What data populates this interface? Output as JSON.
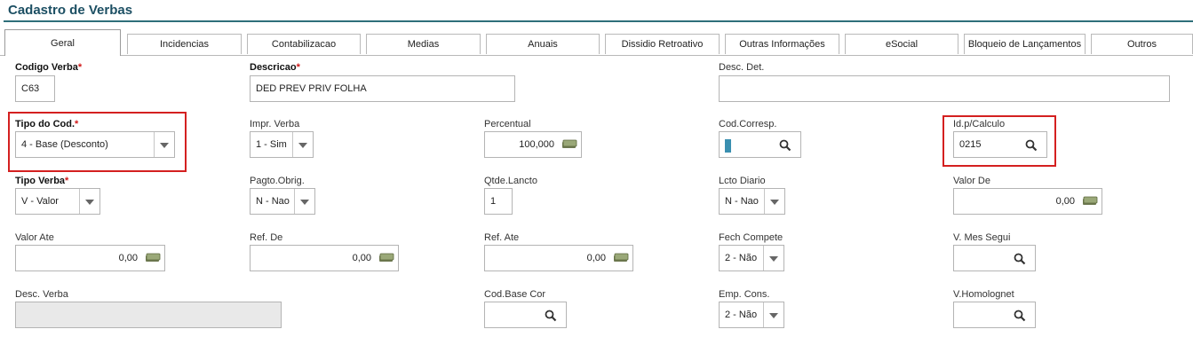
{
  "page": {
    "title": "Cadastro de Verbas"
  },
  "tabs": [
    "Geral",
    "Incidencias",
    "Contabilizacao",
    "Medias",
    "Anuais",
    "Dissidio Retroativo",
    "Outras Informações",
    "eSocial",
    "Bloqueio de Lançamentos",
    "Outros"
  ],
  "fields": {
    "codigo_verba": {
      "label": "Codigo Verba",
      "required": "*",
      "value": "C63"
    },
    "descricao": {
      "label": "Descricao",
      "required": "*",
      "value": "DED PREV PRIV FOLHA"
    },
    "desc_det": {
      "label": "Desc. Det.",
      "value": ""
    },
    "tipo_cod": {
      "label": "Tipo do Cod.",
      "required": "*",
      "value": "4 - Base (Desconto)"
    },
    "impr_verba": {
      "label": "Impr. Verba",
      "value": "1 - Sim"
    },
    "percentual": {
      "label": "Percentual",
      "value": "100,000"
    },
    "cod_corresp": {
      "label": "Cod.Corresp.",
      "value": ""
    },
    "id_calculo": {
      "label": "Id.p/Calculo",
      "value": "0215"
    },
    "tipo_verba": {
      "label": "Tipo Verba",
      "required": "*",
      "value": "V - Valor"
    },
    "pagto_obrig": {
      "label": "Pagto.Obrig.",
      "value": "N - Nao"
    },
    "qtde_lancto": {
      "label": "Qtde.Lancto",
      "value": "1"
    },
    "lcto_diario": {
      "label": "Lcto Diario",
      "value": "N - Nao"
    },
    "valor_de": {
      "label": "Valor De",
      "value": "0,00"
    },
    "valor_ate": {
      "label": "Valor Ate",
      "value": "0,00"
    },
    "ref_de": {
      "label": "Ref. De",
      "value": "0,00"
    },
    "ref_ate": {
      "label": "Ref. Ate",
      "value": "0,00"
    },
    "fech_compete": {
      "label": "Fech Compete",
      "value": "2 - Não"
    },
    "v_mes_segui": {
      "label": "V. Mes Segui",
      "value": ""
    },
    "desc_verba": {
      "label": "Desc. Verba",
      "value": ""
    },
    "cod_base_cor": {
      "label": "Cod.Base Cor",
      "value": ""
    },
    "emp_cons": {
      "label": "Emp. Cons.",
      "value": "2 - Não"
    },
    "v_homolognet": {
      "label": "V.Homolognet",
      "value": ""
    }
  },
  "colors": {
    "title": "#1c4f63",
    "highlight": "#d42020",
    "required": "#d01818"
  },
  "icons": {
    "lookup": "magnifier-icon",
    "calculator": "money-calculator-icon",
    "dropdown": "chevron-down-icon"
  }
}
